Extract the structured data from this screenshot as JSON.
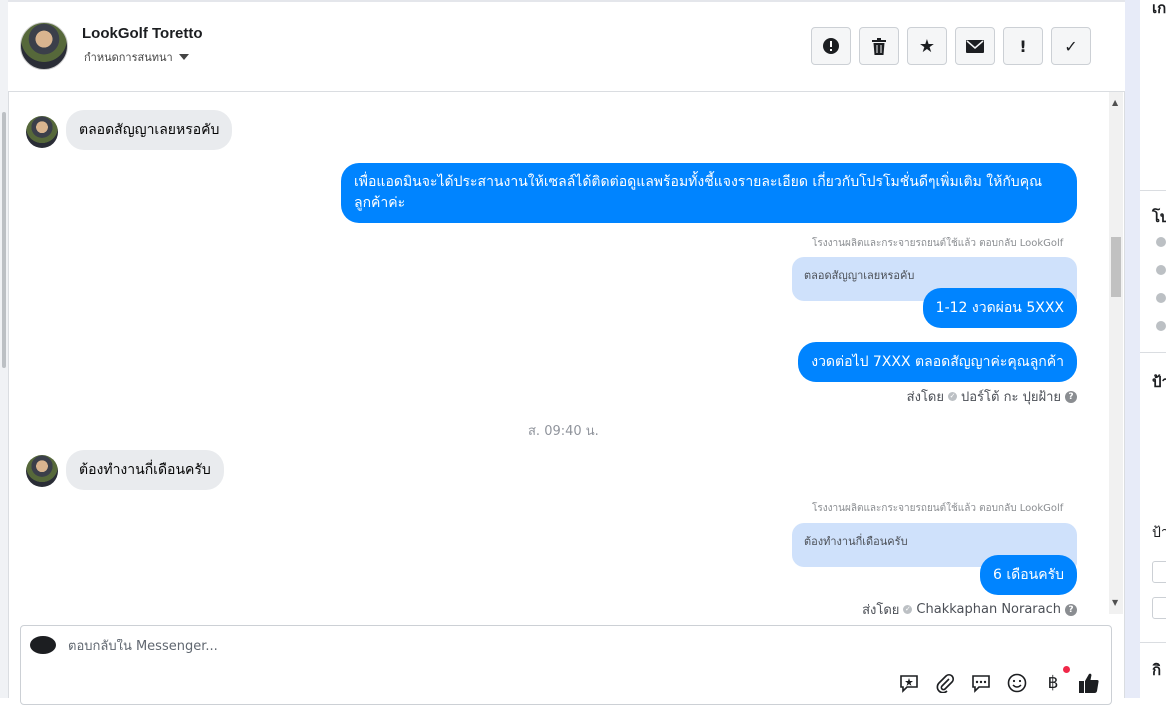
{
  "header": {
    "contact_name": "LookGolf Toretto",
    "assign_label": "กำหนดการสนทนา",
    "toolbar": {
      "spam_icon": "!",
      "delete_icon": "🗑",
      "star_icon": "★",
      "mail_icon": "✉",
      "important_icon": "!",
      "done_icon": "✓"
    }
  },
  "messages": {
    "m1": {
      "text": "ตลอดสัญญาเลยหรอคับ"
    },
    "m2": {
      "text": "เพื่อแอดมินจะได้ประสานงานให้เซลล์ได้ติดต่อดูแลพร้อมทั้งชี้แจงรายละเอียด เกี่ยวกับโปรโมชั่นดีๆเพิ่มเติม ให้กับคุณลูกค้าค่ะ"
    },
    "r1": {
      "meta": "โรงงานผลิตและกระจายรถยนต์ใช้แล้ว ตอบกลับ LookGolf",
      "quote": "ตลอดสัญญาเลยหรอคับ",
      "reply": "1-12 งวดผ่อน 5XXX"
    },
    "m3": {
      "text": "งวดต่อไป 7XXX ตลอดสัญญาค่ะคุณลูกค้า"
    },
    "sender1": {
      "prefix": "ส่งโดย",
      "name": "ปอร์โต้ กะ ปุยฝ้าย"
    },
    "timestamp": "ส. 09:40 น.",
    "m4": {
      "text": "ต้องทำงานกี่เดือนครับ"
    },
    "r2": {
      "meta": "โรงงานผลิตและกระจายรถยนต์ใช้แล้ว ตอบกลับ LookGolf",
      "quote": "ต้องทำงานกี่เดือนครับ",
      "reply": "6 เดือนครับ"
    },
    "sender2": {
      "prefix": "ส่งโดย",
      "name": "Chakkaphan Norarach"
    }
  },
  "composer": {
    "placeholder": "ตอบกลับใน Messenger...",
    "icons": [
      "saved-reply-icon",
      "attach-icon",
      "quick-reply-icon",
      "emoji-icon",
      "payment-icon",
      "like-icon"
    ],
    "like_glyph": "👍",
    "baht_glyph": "฿"
  },
  "right_panel": {
    "c1": "เก",
    "c2": "โบ",
    "c3": "ป้า",
    "c4": "ป้า",
    "c5": "กิ"
  },
  "colors": {
    "accent": "#0084ff",
    "incoming_bubble": "#e9ebee",
    "quote_bg": "#cfe1fb"
  }
}
